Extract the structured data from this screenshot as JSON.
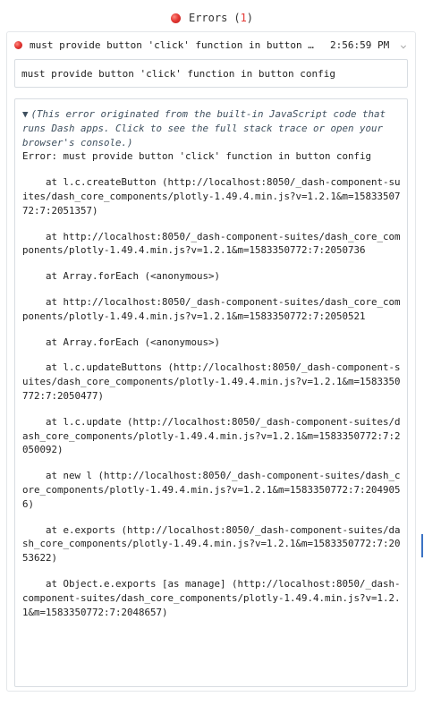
{
  "header": {
    "title": "Errors",
    "count_open": "(",
    "count": "1",
    "count_close": ")"
  },
  "error_item": {
    "title": "must provide button 'click' function in button config",
    "time": "2:56:59 PM",
    "chevron_icon": "chevron-down-icon"
  },
  "message": "must provide button 'click' function in button config",
  "trace": {
    "toggle_icon": "▼",
    "summary": "(This error originated from the built-in JavaScript code that runs Dash apps. Click to see the full stack trace or open your browser's console.)",
    "error_line": "Error: must provide button 'click' function in button config",
    "frames": [
      "at l.c.createButton (http://localhost:8050/_dash-component-suites/dash_core_components/plotly-1.49.4.min.js?v=1.2.1&m=1583350772:7:2051357)",
      "at http://localhost:8050/_dash-component-suites/dash_core_components/plotly-1.49.4.min.js?v=1.2.1&m=1583350772:7:2050736",
      "at Array.forEach (<anonymous>)",
      "at http://localhost:8050/_dash-component-suites/dash_core_components/plotly-1.49.4.min.js?v=1.2.1&m=1583350772:7:2050521",
      "at Array.forEach (<anonymous>)",
      "at l.c.updateButtons (http://localhost:8050/_dash-component-suites/dash_core_components/plotly-1.49.4.min.js?v=1.2.1&m=1583350772:7:2050477)",
      "at l.c.update (http://localhost:8050/_dash-component-suites/dash_core_components/plotly-1.49.4.min.js?v=1.2.1&m=1583350772:7:2050092)",
      "at new l (http://localhost:8050/_dash-component-suites/dash_core_components/plotly-1.49.4.min.js?v=1.2.1&m=1583350772:7:2049056)",
      "at e.exports (http://localhost:8050/_dash-component-suites/dash_core_components/plotly-1.49.4.min.js?v=1.2.1&m=1583350772:7:2053622)",
      "at Object.e.exports [as manage] (http://localhost:8050/_dash-component-suites/dash_core_components/plotly-1.49.4.min.js?v=1.2.1&m=1583350772:7:2048657)"
    ]
  },
  "colors": {
    "error_red": "#e53935",
    "summary_text": "#3e4f5e",
    "border": "#d8dde2"
  }
}
